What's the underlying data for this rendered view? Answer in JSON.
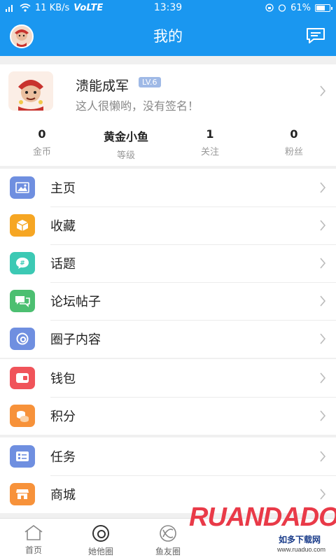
{
  "status_bar": {
    "speed": "11 KB/s",
    "network": "VoLTE",
    "time": "13:39",
    "battery": "61%"
  },
  "header": {
    "title": "我的"
  },
  "profile": {
    "name": "溃能成军",
    "level": "LV.6",
    "signature": "这人很懒哟，没有签名！",
    "stats": [
      {
        "value": "0",
        "label": "金币"
      },
      {
        "value": "黄金小鱼",
        "label": "等级"
      },
      {
        "value": "1",
        "label": "关注"
      },
      {
        "value": "0",
        "label": "粉丝"
      }
    ]
  },
  "menu_groups": [
    [
      {
        "label": "主页",
        "icon": "image-icon",
        "color": "#6f8fe0"
      },
      {
        "label": "收藏",
        "icon": "box-icon",
        "color": "#f6a623"
      },
      {
        "label": "话题",
        "icon": "hashtag-chat-icon",
        "color": "#3cc9b4"
      },
      {
        "label": "论坛帖子",
        "icon": "chat-bubbles-icon",
        "color": "#4cbf71"
      },
      {
        "label": "圈子内容",
        "icon": "ring-icon",
        "color": "#6f8fe0"
      }
    ],
    [
      {
        "label": "钱包",
        "icon": "wallet-icon",
        "color": "#f0545a"
      },
      {
        "label": "积分",
        "icon": "coins-icon",
        "color": "#f7923a"
      }
    ],
    [
      {
        "label": "任务",
        "icon": "task-list-icon",
        "color": "#6f8fe0"
      },
      {
        "label": "商城",
        "icon": "store-icon",
        "color": "#f7923a"
      }
    ]
  ],
  "tabs": [
    {
      "label": "首页",
      "icon": "home-icon"
    },
    {
      "label": "她他圈",
      "icon": "circle-icon"
    },
    {
      "label": "鱼友圈",
      "icon": "compass-icon"
    }
  ],
  "watermark": {
    "logo": "RUANDADO",
    "text": "如多下载网",
    "url": "www.ruaduo.com"
  }
}
